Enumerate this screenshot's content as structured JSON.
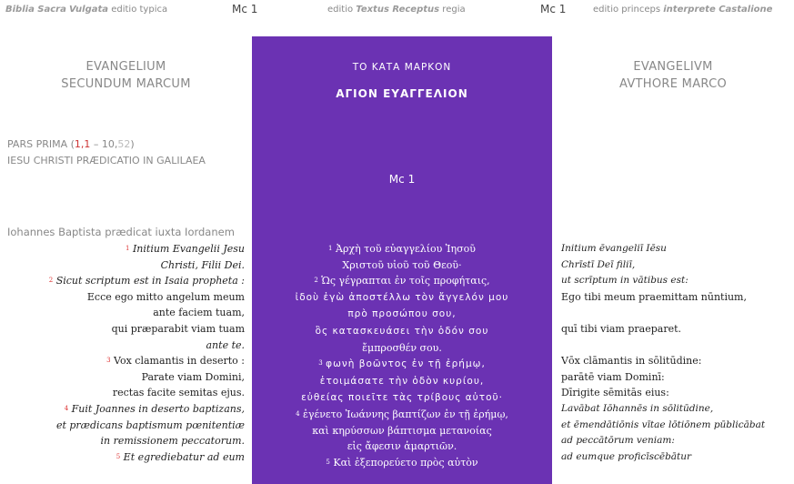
{
  "top_bar": {
    "left_a": "Biblia Sacra",
    "left_b": "Vulgata",
    "left_c": "editio typica",
    "left_mc": "Mc 1",
    "mid_a": "editio",
    "mid_b": "Textus Receptus",
    "mid_c": "regia",
    "right_mc": "Mc 1",
    "right_a": "editio princeps",
    "right_b": "interprete Castalione"
  },
  "left": {
    "heading_1": "EVANGELIUM",
    "heading_2": "SECUNDUM MARCUM",
    "pars_label": "PARS PRIMA (",
    "pars_a": "1,1",
    "pars_dash": " – ",
    "pars_b": "10,",
    "pars_c": "52",
    "pars_close": ")",
    "pars_title": "IESU CHRISTI PRÆDICATIO IN GALILAEA",
    "rubric": "Iohannes Baptista prædicat iuxta Iordanem",
    "lines": [
      {
        "n": "1",
        "t": "Initium Evangelii Jesu",
        "i": true
      },
      {
        "n": "",
        "t": "Christi, Filii Dei.",
        "i": true
      },
      {
        "n": "2",
        "t": "Sicut scriptum est in Isaia propheta :",
        "i": true
      },
      {
        "n": "",
        "t": "Ecce ego mitto angelum meum",
        "i": false
      },
      {
        "n": "",
        "t": "ante faciem tuam,",
        "i": false
      },
      {
        "n": "",
        "t": "qui præparabit viam tuam",
        "i": false
      },
      {
        "n": "",
        "t": "ante te.",
        "i": true
      },
      {
        "n": "3",
        "t": "Vox clamantis in deserto :",
        "i": false
      },
      {
        "n": "",
        "t": "Parate viam Domini,",
        "i": false
      },
      {
        "n": "",
        "t": "rectas facite semitas ejus.",
        "i": false
      },
      {
        "n": "4",
        "t": "Fuit Joannes in deserto baptizans,",
        "i": true
      },
      {
        "n": "",
        "t": "et prædicans baptismum pœnitentiæ",
        "i": true
      },
      {
        "n": "",
        "t": "in remissionem peccatorum.",
        "i": true
      },
      {
        "n": "5",
        "t": "Et egrediebatur ad eum",
        "i": true
      }
    ]
  },
  "middle": {
    "title_1": "ΤΟ ΚΑΤΑ ΜΑΡΚΟΝ",
    "title_2": "ΑΓΙΟΝ ΕΥΑΓΓΕΛΙΟΝ",
    "ref": "Mc 1",
    "lines": [
      {
        "n": "1",
        "t": "Ἀρχὴ τοῦ εὐαγγελίου Ἰησοῦ",
        "u": false
      },
      {
        "n": "",
        "t": "Χριστοῦ υἱοῦ τοῦ Θεοῦ·",
        "u": false
      },
      {
        "n": "2",
        "t": "Ὡς γέγραπται ἐν τοῖς προφήταις,",
        "u": false
      },
      {
        "n": "",
        "t": "ἰδοὺ ἐγὼ ἀποστέλλω τὸν ἄγγελόν μου",
        "u": true
      },
      {
        "n": "",
        "t": "πρὸ προσώπου σου,",
        "u": true
      },
      {
        "n": "",
        "t": "ὃς κατασκευάσει τὴν ὁδόν σου",
        "u": true
      },
      {
        "n": "",
        "t": "ἔμπροσθέν σου.",
        "u": false
      },
      {
        "n": "3",
        "t": "φωνὴ βοῶντος ἐν τῇ ἐρήμῳ,",
        "u": true
      },
      {
        "n": "",
        "t": "ἑτοιμάσατε τὴν ὁδὸν κυρίου,",
        "u": true
      },
      {
        "n": "",
        "t": "εὐθείας ποιεῖτε τὰς τρίβους αὐτοῦ·",
        "u": true
      },
      {
        "n": "4",
        "t": "ἐγένετο Ἰωάννης βαπτίζων ἐν τῇ ἐρήμῳ,",
        "u": false
      },
      {
        "n": "",
        "t": "καὶ κηρύσσων βάπτισμα μετανοίας",
        "u": false
      },
      {
        "n": "",
        "t": "εἰς ἄφεσιν ἁμαρτιῶν.",
        "u": false
      },
      {
        "n": "5",
        "t": "Καὶ ἐξεπορεύετο πρὸς αὐτὸν",
        "u": false
      }
    ]
  },
  "right": {
    "heading_1": "EVANGELIVM",
    "heading_2": "AVTHORE MARCO",
    "lines": [
      {
        "t": "Initium ēvangeliī Iēsu",
        "i": true
      },
      {
        "t": "Chrīstī Deī filiī,",
        "i": true
      },
      {
        "t": "ut scrīptum in vātibus est:",
        "i": true
      },
      {
        "t": "Ego tibi meum praemittam nūntium,",
        "i": false
      },
      {
        "t": "",
        "i": false
      },
      {
        "t": "quī tibi viam praeparet.",
        "i": false
      },
      {
        "t": "",
        "i": false
      },
      {
        "t": "Vōx clāmantis in sōlitūdine:",
        "i": false
      },
      {
        "t": "parātē viam Dominī:",
        "i": false
      },
      {
        "t": "Dīrigite sēmitās eius:",
        "i": false
      },
      {
        "t": "Lavābat Iōhannēs in sōlitūdine,",
        "i": true
      },
      {
        "t": "et ēmendātiōnis vītae lōtiōnem pūblicābat",
        "i": true
      },
      {
        "t": "ad peccātōrum veniam:",
        "i": true
      },
      {
        "t": "ad eumque proficīscēbātur",
        "i": true
      }
    ]
  }
}
